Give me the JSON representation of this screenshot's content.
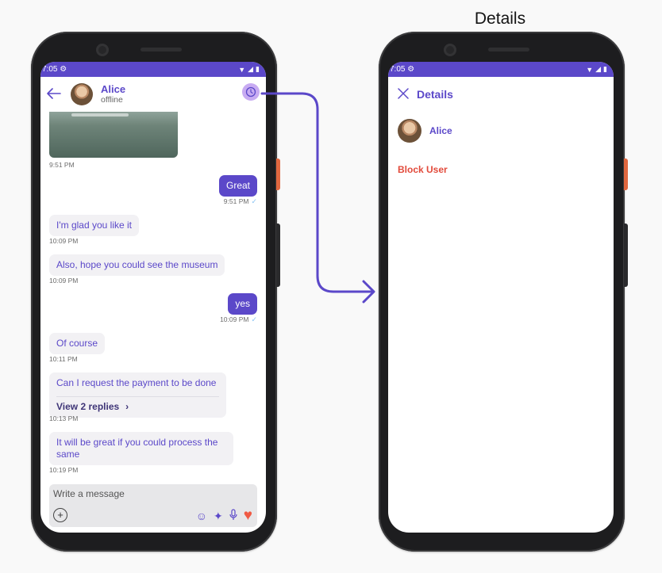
{
  "caption": "Details",
  "status": {
    "time": "7:05"
  },
  "chat": {
    "contact_name": "Alice",
    "contact_status": "offline",
    "messages": [
      {
        "time": "9:51 PM"
      },
      {
        "text": "Great",
        "time": "9:51 PM"
      },
      {
        "text": "I'm glad you like it",
        "time": "10:09 PM"
      },
      {
        "text": "Also, hope you could see the museum",
        "time": "10:09 PM"
      },
      {
        "text": "yes",
        "time": "10:09 PM"
      },
      {
        "text": "Of course",
        "time": "10:11 PM"
      },
      {
        "text": "Can I request the payment to be done",
        "replies": "View 2 replies",
        "time": "10:13 PM"
      },
      {
        "text": "It will be great if you could process the same",
        "time": "10:19 PM"
      }
    ],
    "composer_placeholder": "Write a message"
  },
  "details": {
    "title": "Details",
    "user_name": "Alice",
    "block_label": "Block User"
  },
  "colors": {
    "accent": "#5b48c9",
    "danger": "#e24a3b",
    "heart": "#f05a44"
  },
  "icons": [
    "back-arrow-icon",
    "info-icon",
    "close-icon",
    "add-icon",
    "sticker-icon",
    "ai-sparkle-icon",
    "mic-icon",
    "heart-icon",
    "check-icon",
    "chevron-right-icon"
  ]
}
